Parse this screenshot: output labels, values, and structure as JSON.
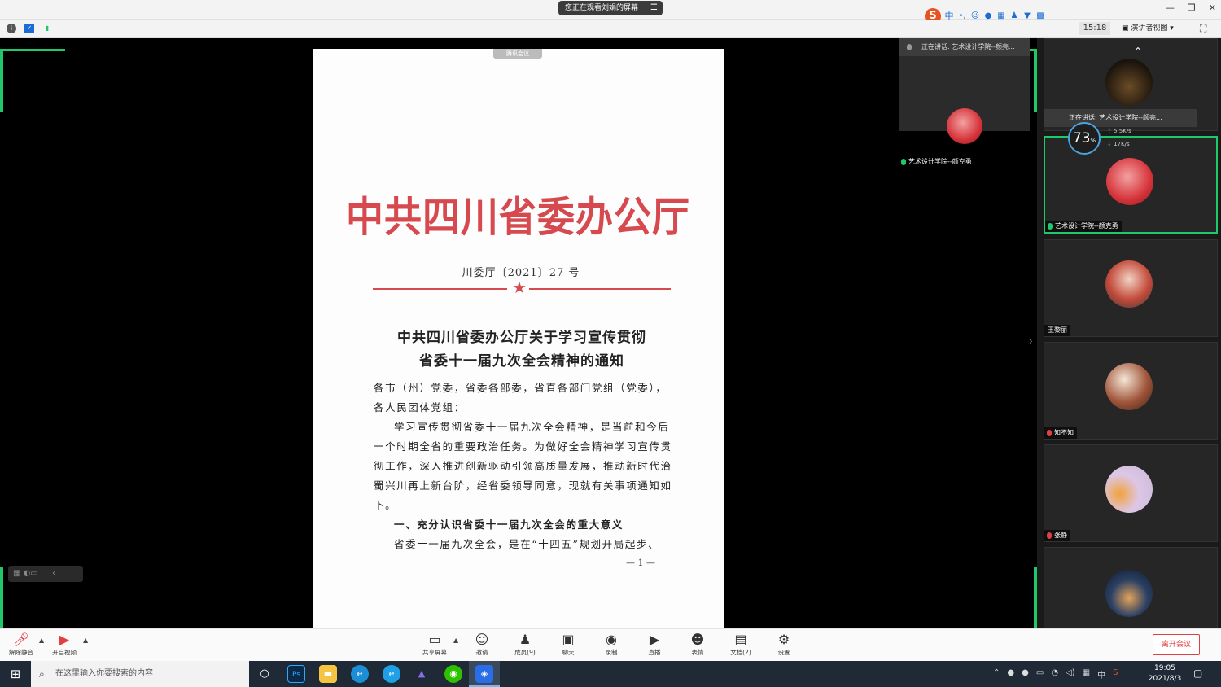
{
  "titlebar": {
    "share_banner": "您正在观看刘娟的屏幕",
    "ime_logo": "S",
    "ime_mode": "中",
    "window_controls": [
      "—",
      "❐",
      "✕"
    ]
  },
  "toolbar2": {
    "time": "15:18",
    "view_mode": "演讲者视图"
  },
  "document": {
    "tag": "腾讯会议",
    "header": "中共四川省委办公厅",
    "doc_number": "川委厅〔2021〕27 号",
    "title_line1": "中共四川省委办公厅关于学习宣传贯彻",
    "title_line2": "省委十一届九次全会精神的通知",
    "body": [
      "各市（州）党委，省委各部委，省直各部门党组（党委），",
      "各人民团体党组：",
      "学习宣传贯彻省委十一届九次全会精神，是当前和今后一个时期全省的重要政治任务。为做好全会精神学习宣传贯彻工作，深入推进创新驱动引领高质量发展，推动新时代治蜀兴川再上新台阶，经省委领导同意，现就有关事项通知如下。",
      "一、充分认识省委十一届九次全会的重大意义",
      "省委十一届九次全会，是在“十四五”规划开局起步、"
    ],
    "page_number": "— 1 —"
  },
  "speaker_float": {
    "status": "正在讲话: 艺术设计学院--颜亮...",
    "name": "艺术设计学院--颜克勇"
  },
  "gallery": {
    "speaking_popup": "正在讲话: 艺术设计学院--颜亮...",
    "net_percent": "73",
    "net_unit": "%",
    "upload": "5.5K/s",
    "download": "17K/s",
    "participants": [
      {
        "name": ""
      },
      {
        "name": "艺术设计学院--颜克勇"
      },
      {
        "name": "王黎丽"
      },
      {
        "name": "知不知"
      },
      {
        "name": "张静"
      },
      {
        "name": ""
      }
    ]
  },
  "controls": {
    "unmute": "解除静音",
    "start_video": "开启视频",
    "share_screen": "共享屏幕",
    "invite": "邀请",
    "members": "成员(9)",
    "chat": "聊天",
    "record": "录制",
    "live": "直播",
    "reactions": "表情",
    "docs": "文档(2)",
    "settings": "设置",
    "leave": "离开会议"
  },
  "taskbar": {
    "search_placeholder": "在这里输入你要搜索的内容",
    "tray_ime": "中",
    "time": "19:05",
    "date": "2021/8/3"
  },
  "colors": {
    "accent_green": "#1fc96a",
    "doc_red": "#d64a4f",
    "leave_red": "#e04040"
  }
}
